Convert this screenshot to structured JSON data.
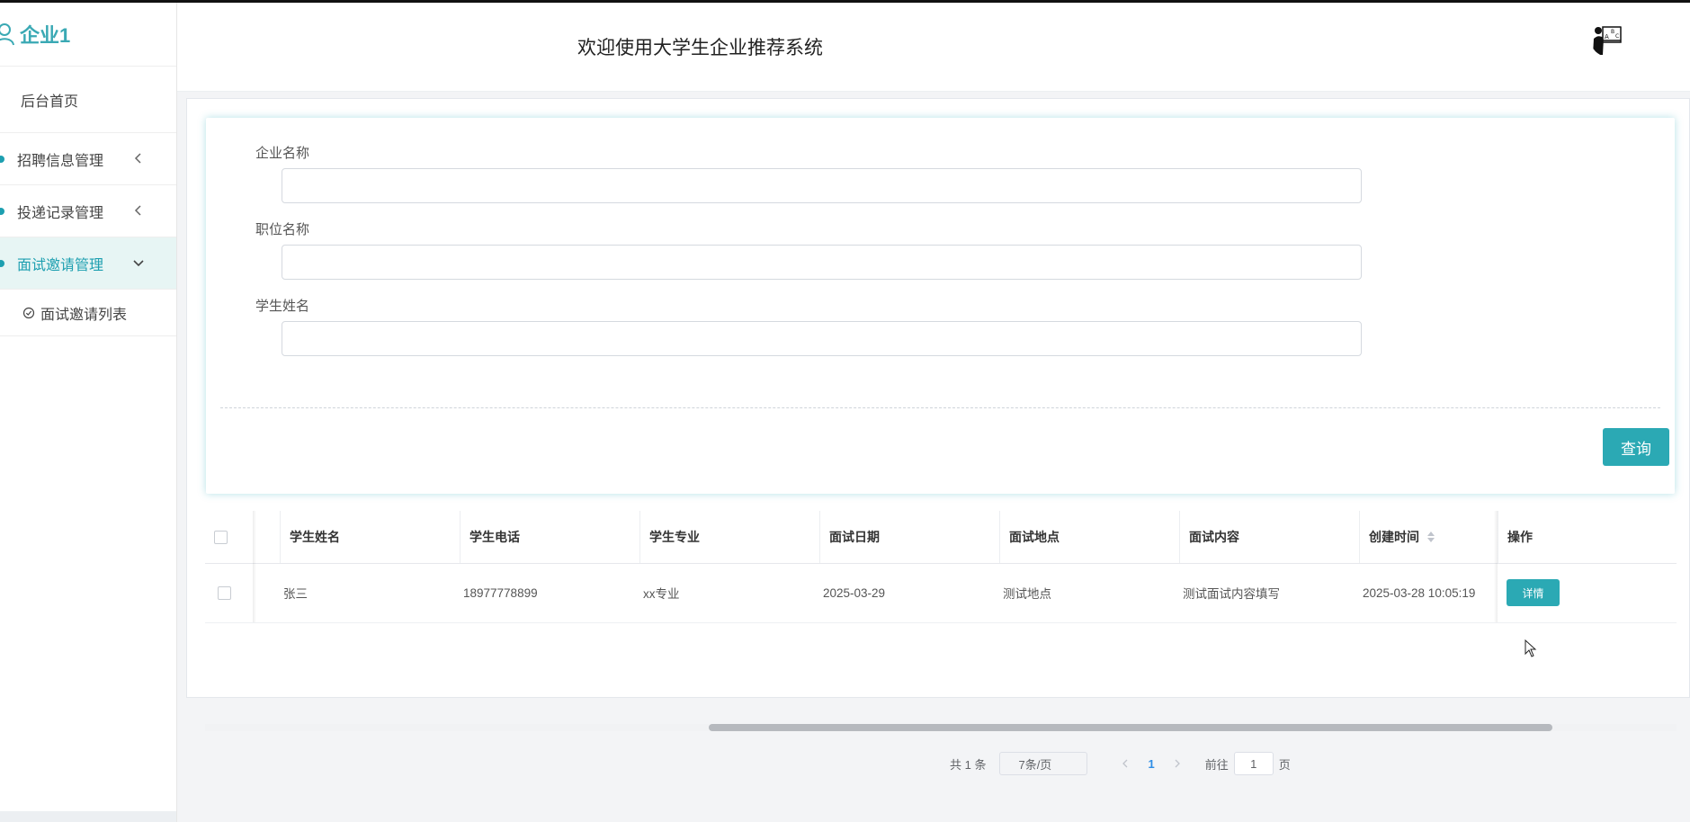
{
  "sidebar": {
    "brand": "企业1",
    "home": "后台首页",
    "menus": [
      {
        "label": "招聘信息管理",
        "expanded": false
      },
      {
        "label": "投递记录管理",
        "expanded": false
      },
      {
        "label": "面试邀请管理",
        "expanded": true
      }
    ],
    "submenu": "面试邀请列表"
  },
  "header": {
    "title": "欢迎使用大学生企业推荐系统"
  },
  "search": {
    "fields": [
      {
        "label": "企业名称",
        "value": ""
      },
      {
        "label": "职位名称",
        "value": ""
      },
      {
        "label": "学生姓名",
        "value": ""
      }
    ],
    "button": "查询"
  },
  "table": {
    "columns": [
      "学生姓名",
      "学生电话",
      "学生专业",
      "面试日期",
      "面试地点",
      "面试内容",
      "创建时间",
      "操作"
    ],
    "rows": [
      {
        "name": "张三",
        "phone": "18977778899",
        "major": "xx专业",
        "date": "2025-03-29",
        "place": "测试地点",
        "content": "测试面试内容填写",
        "created": "2025-03-28 10:05:19",
        "action": "详情"
      }
    ]
  },
  "pagination": {
    "total": "共 1 条",
    "page_size": "7条/页",
    "current": "1",
    "goto_label": "前往",
    "goto_value": "1",
    "page_suffix": "页"
  },
  "colors": {
    "accent": "#2ba9b4",
    "page_link": "#2e8de6"
  }
}
